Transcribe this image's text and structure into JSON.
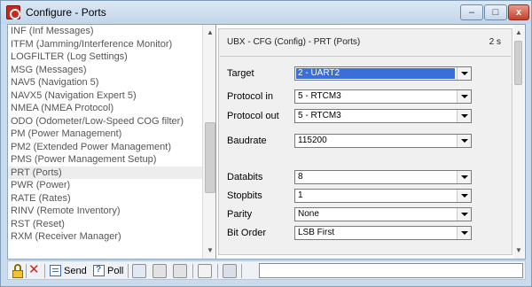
{
  "window": {
    "title": "Configure - Ports",
    "min_label": "–",
    "max_label": "□",
    "close_label": "x"
  },
  "message_list": {
    "items": [
      "INF (Inf Messages)",
      "ITFM (Jamming/Interference Monitor)",
      "LOGFILTER (Log Settings)",
      "MSG (Messages)",
      "NAV5 (Navigation 5)",
      "NAVX5 (Navigation Expert 5)",
      "NMEA (NMEA Protocol)",
      "ODO (Odometer/Low-Speed COG filter)",
      "PM (Power Management)",
      "PM2 (Extended Power Management)",
      "PMS (Power Management Setup)",
      "PRT (Ports)",
      "PWR (Power)",
      "RATE (Rates)",
      "RINV (Remote Inventory)",
      "RST (Reset)",
      "RXM (Receiver Manager)"
    ],
    "selected_index": 11
  },
  "config": {
    "header": "UBX - CFG (Config) - PRT (Ports)",
    "timer": "2 s",
    "fields": {
      "target": {
        "label": "Target",
        "value": "2 - UART2"
      },
      "protocol_in": {
        "label": "Protocol in",
        "value": "5 - RTCM3"
      },
      "protocol_out": {
        "label": "Protocol out",
        "value": "5 - RTCM3"
      },
      "baudrate": {
        "label": "Baudrate",
        "value": "115200"
      },
      "databits": {
        "label": "Databits",
        "value": "8"
      },
      "stopbits": {
        "label": "Stopbits",
        "value": "1"
      },
      "parity": {
        "label": "Parity",
        "value": "None"
      },
      "bit_order": {
        "label": "Bit Order",
        "value": "LSB First"
      }
    }
  },
  "toolbar": {
    "send_label": "Send",
    "poll_label": "Poll",
    "icons": [
      "lock-icon",
      "delete-icon",
      "send-icon",
      "poll-icon",
      "tool-icon",
      "grid-icon",
      "window-icon",
      "page-icon",
      "save-icon"
    ]
  },
  "colors": {
    "selection": "#3a6fd9",
    "close_button": "#c4402b"
  }
}
